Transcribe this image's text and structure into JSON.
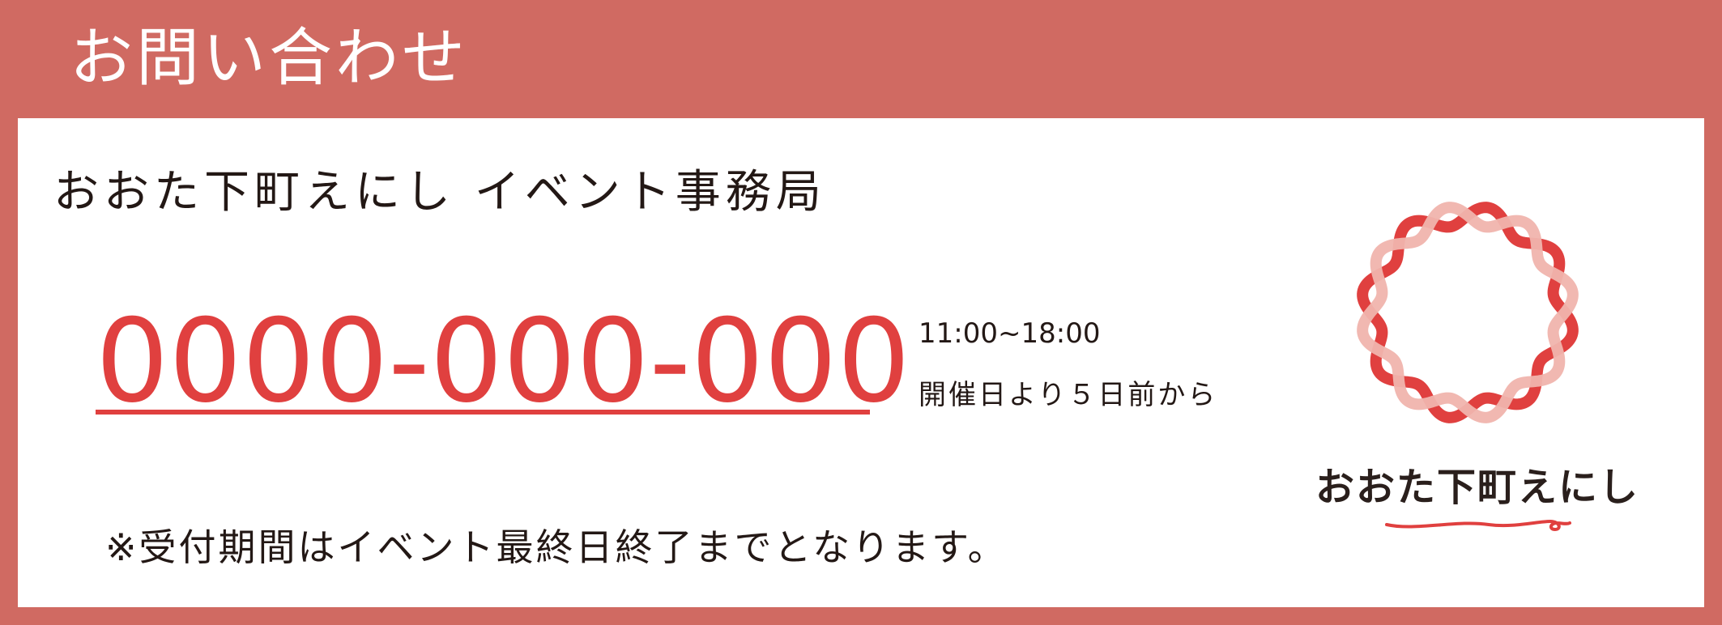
{
  "header": {
    "title": "お問い合わせ"
  },
  "contact": {
    "organization": "おおた下町えにし イベント事務局",
    "phone": "0000-000-000",
    "hours": "11:00~18:00",
    "period": "開催日より５日前から",
    "note": "※受付期間はイベント最終日終了までとなります。"
  },
  "logo": {
    "text": "おおた下町えにし",
    "icon": "ring-knot-logo"
  },
  "colors": {
    "background": "#d06a62",
    "accent": "#e0403f",
    "ring_light": "#f0b4ad",
    "text": "#231815"
  }
}
